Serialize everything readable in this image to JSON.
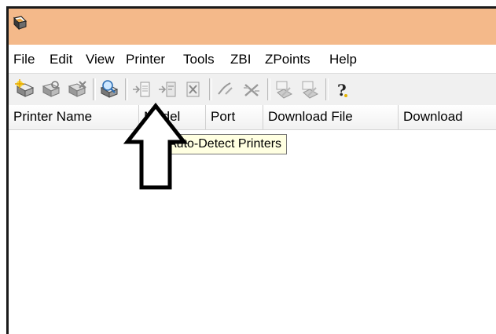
{
  "menu": {
    "items": [
      "File",
      "Edit",
      "View",
      "Printer",
      "Tools",
      "ZBI",
      "ZPoints",
      "Help"
    ]
  },
  "toolbar": {
    "buttons": [
      {
        "icon": "new-printer-icon"
      },
      {
        "icon": "printer-properties-icon"
      },
      {
        "icon": "delete-printer-icon"
      },
      {
        "icon": "auto-detect-printers-icon"
      },
      {
        "icon": "send-file-icon"
      },
      {
        "icon": "send-command-icon"
      },
      {
        "icon": "cancel-job-icon"
      },
      {
        "icon": "connect-icon"
      },
      {
        "icon": "disconnect-icon"
      },
      {
        "icon": "epl-icon"
      },
      {
        "icon": "zpl-icon"
      },
      {
        "icon": "help-icon"
      }
    ]
  },
  "list": {
    "columns": [
      "Printer Name",
      "Model",
      "Port",
      "Download File",
      "Download"
    ]
  },
  "tooltip": {
    "text": "Auto-Detect Printers"
  },
  "colors": {
    "titlebar": "#f4b98a",
    "tooltip_bg": "#ffffe1",
    "toolbar_bg": "#f0f0f0"
  }
}
